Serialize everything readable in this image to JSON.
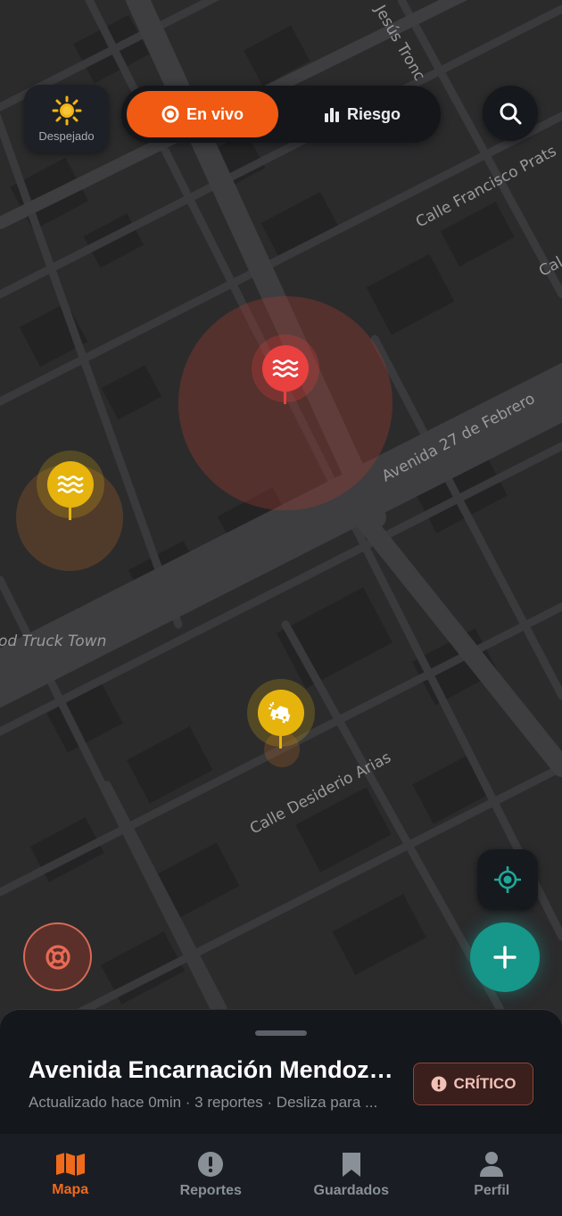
{
  "weather": {
    "label": "Despejado",
    "icon": "sun-icon"
  },
  "mode_toggle": {
    "live_label": "En vivo",
    "risk_label": "Riesgo",
    "active": "live",
    "accent": "#f05a12"
  },
  "map": {
    "street_labels": [
      "Jesús Tronc",
      "Calle Francisco Prats",
      "Cal",
      "Avenida 27 de Febrero",
      "od Truck Town",
      "Calle Desiderio Arias"
    ],
    "markers": [
      {
        "type": "flood",
        "severity": "critical",
        "color": "#e94040",
        "icon": "flood-waves-icon"
      },
      {
        "type": "flood",
        "severity": "medium",
        "color": "#e6b40d",
        "icon": "flood-waves-icon"
      },
      {
        "type": "car-accident",
        "severity": "medium",
        "color": "#e6b40d",
        "icon": "car-crash-icon"
      }
    ]
  },
  "location_sheet": {
    "title": "Avenida Encarnación Mendoza,...",
    "subtitle": "Actualizado hace 0min · 3 reportes · Desliza para ...",
    "badge": "CRÍTICO"
  },
  "nav": {
    "items": [
      {
        "label": "Mapa",
        "icon": "map-icon",
        "active": true
      },
      {
        "label": "Reportes",
        "icon": "alert-circle-icon",
        "active": false
      },
      {
        "label": "Guardados",
        "icon": "bookmark-icon",
        "active": false
      },
      {
        "label": "Perfil",
        "icon": "user-icon",
        "active": false
      }
    ]
  },
  "colors": {
    "accent": "#f05a12",
    "teal": "#17968a",
    "critical": "#e94040",
    "warning": "#e6b40d"
  }
}
